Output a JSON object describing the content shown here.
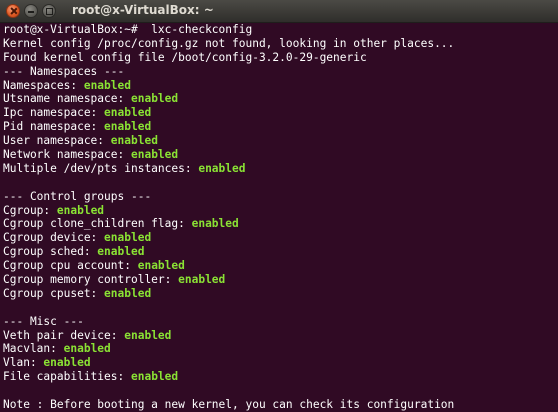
{
  "window": {
    "title": "root@x-VirtualBox: ~",
    "colors": {
      "background": "#300a24",
      "text": "#ffffff",
      "enabled": "#8ae234"
    }
  },
  "terminal": {
    "lines": [
      {
        "text": "root@x-VirtualBox:~#  lxc-checkconfig",
        "status": ""
      },
      {
        "text": "Kernel config /proc/config.gz not found, looking in other places...",
        "status": ""
      },
      {
        "text": "Found kernel config file /boot/config-3.2.0-29-generic",
        "status": ""
      },
      {
        "text": "--- Namespaces ---",
        "status": ""
      },
      {
        "text": "Namespaces: ",
        "status": "enabled"
      },
      {
        "text": "Utsname namespace: ",
        "status": "enabled"
      },
      {
        "text": "Ipc namespace: ",
        "status": "enabled"
      },
      {
        "text": "Pid namespace: ",
        "status": "enabled"
      },
      {
        "text": "User namespace: ",
        "status": "enabled"
      },
      {
        "text": "Network namespace: ",
        "status": "enabled"
      },
      {
        "text": "Multiple /dev/pts instances: ",
        "status": "enabled"
      },
      {
        "text": "",
        "status": ""
      },
      {
        "text": "--- Control groups ---",
        "status": ""
      },
      {
        "text": "Cgroup: ",
        "status": "enabled"
      },
      {
        "text": "Cgroup clone_children flag: ",
        "status": "enabled"
      },
      {
        "text": "Cgroup device: ",
        "status": "enabled"
      },
      {
        "text": "Cgroup sched: ",
        "status": "enabled"
      },
      {
        "text": "Cgroup cpu account: ",
        "status": "enabled"
      },
      {
        "text": "Cgroup memory controller: ",
        "status": "enabled"
      },
      {
        "text": "Cgroup cpuset: ",
        "status": "enabled"
      },
      {
        "text": "",
        "status": ""
      },
      {
        "text": "--- Misc ---",
        "status": ""
      },
      {
        "text": "Veth pair device: ",
        "status": "enabled"
      },
      {
        "text": "Macvlan: ",
        "status": "enabled"
      },
      {
        "text": "Vlan: ",
        "status": "enabled"
      },
      {
        "text": "File capabilities: ",
        "status": "enabled"
      },
      {
        "text": "",
        "status": ""
      },
      {
        "text": "Note : Before booting a new kernel, you can check its configuration",
        "status": ""
      }
    ]
  }
}
